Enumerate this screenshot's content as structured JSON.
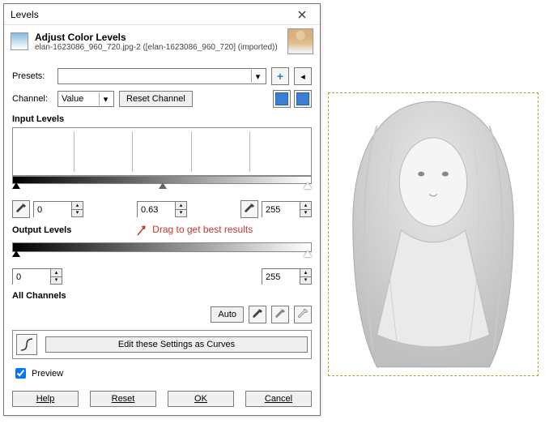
{
  "dialog": {
    "title": "Levels",
    "heading": "Adjust Color Levels",
    "subtitle": "elan-1623086_960_720.jpg-2 ([elan-1623086_960_720] (imported))"
  },
  "presets": {
    "label": "Presets:",
    "value": ""
  },
  "channel": {
    "label": "Channel:",
    "value": "Value",
    "reset": "Reset Channel"
  },
  "input_levels": {
    "label": "Input Levels",
    "low": "0",
    "gamma": "0.63",
    "high": "255"
  },
  "annotation": "Drag to get best results",
  "output_levels": {
    "label": "Output Levels",
    "low": "0",
    "high": "255"
  },
  "all_channels": {
    "label": "All Channels",
    "auto": "Auto"
  },
  "curves": {
    "label": "Edit these Settings as Curves"
  },
  "preview": {
    "label": "Preview",
    "checked": true
  },
  "buttons": {
    "help": "Help",
    "reset": "Reset",
    "ok": "OK",
    "cancel": "Cancel"
  }
}
